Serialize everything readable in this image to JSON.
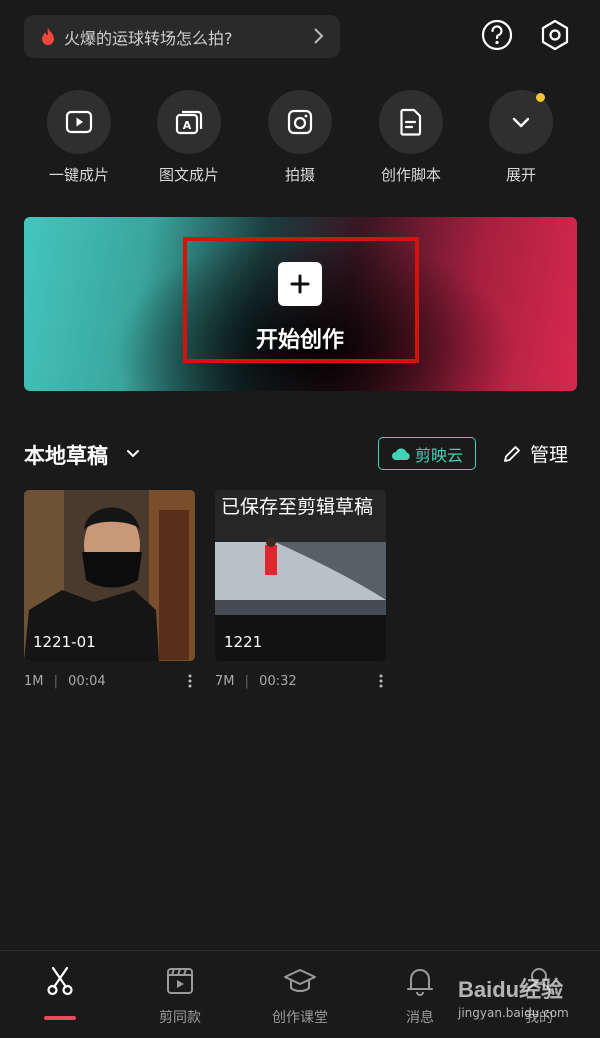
{
  "search": {
    "text": "火爆的运球转场怎么拍?",
    "icon": "fire-icon"
  },
  "top_icons": [
    "help-icon",
    "settings-icon"
  ],
  "quick_actions": [
    {
      "label": "一键成片",
      "icon": "play-square-icon"
    },
    {
      "label": "图文成片",
      "icon": "text-image-icon"
    },
    {
      "label": "拍摄",
      "icon": "camera-icon"
    },
    {
      "label": "创作脚本",
      "icon": "script-icon"
    },
    {
      "label": "展开",
      "icon": "chevron-down-icon"
    }
  ],
  "banner": {
    "label": "开始创作"
  },
  "drafts": {
    "title": "本地草稿",
    "cloud_button": "剪映云",
    "manage_label": "管理",
    "saved_toast": "已保存至剪辑草稿",
    "items": [
      {
        "name": "1221-01",
        "size": "1M",
        "duration": "00:04"
      },
      {
        "name": "1221",
        "size": "7M",
        "duration": "00:32"
      }
    ]
  },
  "nav": {
    "items": [
      {
        "label": "",
        "icon": "scissors-icon",
        "active": true
      },
      {
        "label": "剪同款",
        "icon": "template-icon"
      },
      {
        "label": "创作课堂",
        "icon": "graduation-cap-icon"
      },
      {
        "label": "消息",
        "icon": "bell-icon"
      },
      {
        "label": "我的",
        "icon": "profile-icon"
      }
    ]
  },
  "watermark": {
    "brand": "Baidu经验",
    "url": "jingyan.baidu.com"
  },
  "colors": {
    "accent_teal": "#3fd4b6",
    "active_red": "#f04a5d",
    "highlight_frame": "#d0150f"
  }
}
